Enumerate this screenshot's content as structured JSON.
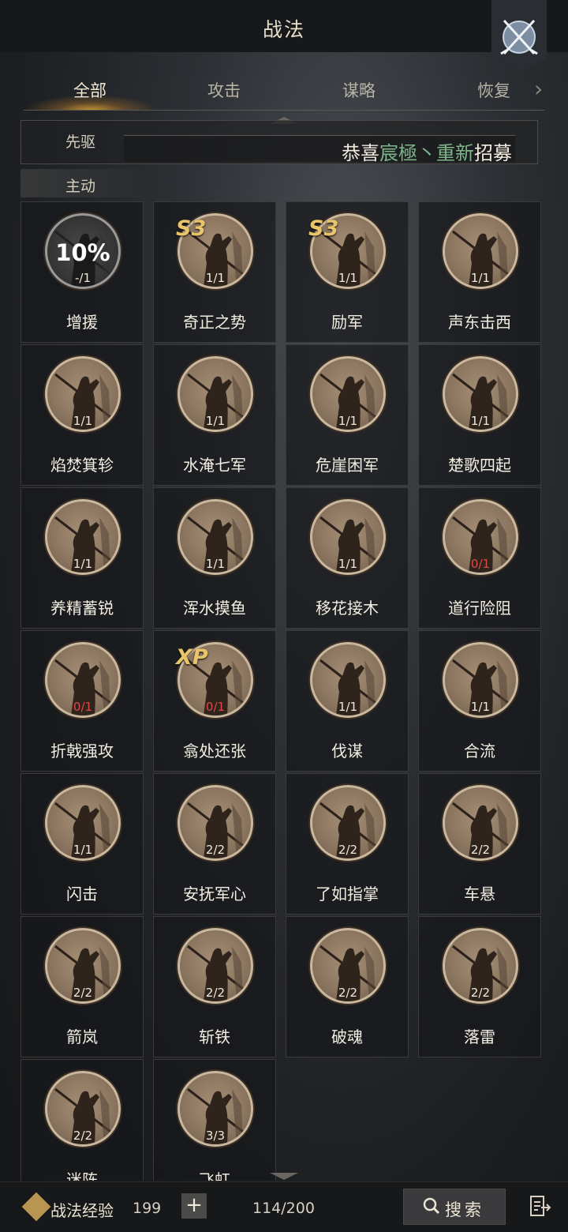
{
  "header": {
    "title": "战法"
  },
  "tabs": [
    {
      "label": "全部",
      "active": true
    },
    {
      "label": "攻击",
      "active": false
    },
    {
      "label": "谋略",
      "active": false
    },
    {
      "label": "恢复",
      "active": false
    }
  ],
  "banner": {
    "parts": [
      {
        "text": "恭喜",
        "highlight": false
      },
      {
        "text": "宸極丶重新",
        "highlight": true
      },
      {
        "text": "招募",
        "highlight": false
      }
    ]
  },
  "sections": {
    "vanguard": "先驱",
    "active": "主动"
  },
  "skills": [
    {
      "name": "增援",
      "count": "-/1",
      "percent": "10%",
      "badge": "",
      "red": false,
      "locked": true
    },
    {
      "name": "奇正之势",
      "count": "1/1",
      "percent": "",
      "badge": "S3",
      "red": false,
      "locked": false
    },
    {
      "name": "励军",
      "count": "1/1",
      "percent": "",
      "badge": "S3",
      "red": false,
      "locked": false
    },
    {
      "name": "声东击西",
      "count": "1/1",
      "percent": "",
      "badge": "",
      "red": false,
      "locked": false
    },
    {
      "name": "焰焚箕轸",
      "count": "1/1",
      "percent": "",
      "badge": "",
      "red": false,
      "locked": false
    },
    {
      "name": "水淹七军",
      "count": "1/1",
      "percent": "",
      "badge": "",
      "red": false,
      "locked": false
    },
    {
      "name": "危崖困军",
      "count": "1/1",
      "percent": "",
      "badge": "",
      "red": false,
      "locked": false
    },
    {
      "name": "楚歌四起",
      "count": "1/1",
      "percent": "",
      "badge": "",
      "red": false,
      "locked": false
    },
    {
      "name": "养精蓄锐",
      "count": "1/1",
      "percent": "",
      "badge": "",
      "red": false,
      "locked": false
    },
    {
      "name": "浑水摸鱼",
      "count": "1/1",
      "percent": "",
      "badge": "",
      "red": false,
      "locked": false
    },
    {
      "name": "移花接木",
      "count": "1/1",
      "percent": "",
      "badge": "",
      "red": false,
      "locked": false
    },
    {
      "name": "道行险阻",
      "count": "0/1",
      "percent": "",
      "badge": "",
      "red": true,
      "locked": false
    },
    {
      "name": "折戟强攻",
      "count": "0/1",
      "percent": "",
      "badge": "",
      "red": true,
      "locked": false
    },
    {
      "name": "翕处还张",
      "count": "0/1",
      "percent": "",
      "badge": "XP",
      "red": true,
      "locked": false
    },
    {
      "name": "伐谋",
      "count": "1/1",
      "percent": "",
      "badge": "",
      "red": false,
      "locked": false
    },
    {
      "name": "合流",
      "count": "1/1",
      "percent": "",
      "badge": "",
      "red": false,
      "locked": false
    },
    {
      "name": "闪击",
      "count": "1/1",
      "percent": "",
      "badge": "",
      "red": false,
      "locked": false
    },
    {
      "name": "安抚军心",
      "count": "2/2",
      "percent": "",
      "badge": "",
      "red": false,
      "locked": false
    },
    {
      "name": "了如指掌",
      "count": "2/2",
      "percent": "",
      "badge": "",
      "red": false,
      "locked": false
    },
    {
      "name": "车悬",
      "count": "2/2",
      "percent": "",
      "badge": "",
      "red": false,
      "locked": false
    },
    {
      "name": "箭岚",
      "count": "2/2",
      "percent": "",
      "badge": "",
      "red": false,
      "locked": false
    },
    {
      "name": "斩铁",
      "count": "2/2",
      "percent": "",
      "badge": "",
      "red": false,
      "locked": false
    },
    {
      "name": "破魂",
      "count": "2/2",
      "percent": "",
      "badge": "",
      "red": false,
      "locked": false
    },
    {
      "name": "落雷",
      "count": "2/2",
      "percent": "",
      "badge": "",
      "red": false,
      "locked": false
    },
    {
      "name": "迷阵",
      "count": "2/2",
      "percent": "",
      "badge": "",
      "red": false,
      "locked": false
    },
    {
      "name": "飞虹",
      "count": "3/3",
      "percent": "",
      "badge": "",
      "red": false,
      "locked": false
    }
  ],
  "footer": {
    "exp_label": "战法经验",
    "exp_value": "199",
    "plus": "+",
    "capacity": "114/200",
    "search_label": "搜索"
  },
  "colors": {
    "accent": "#e8c46a",
    "highlight_green": "#7fb58a",
    "red": "#e04848"
  }
}
